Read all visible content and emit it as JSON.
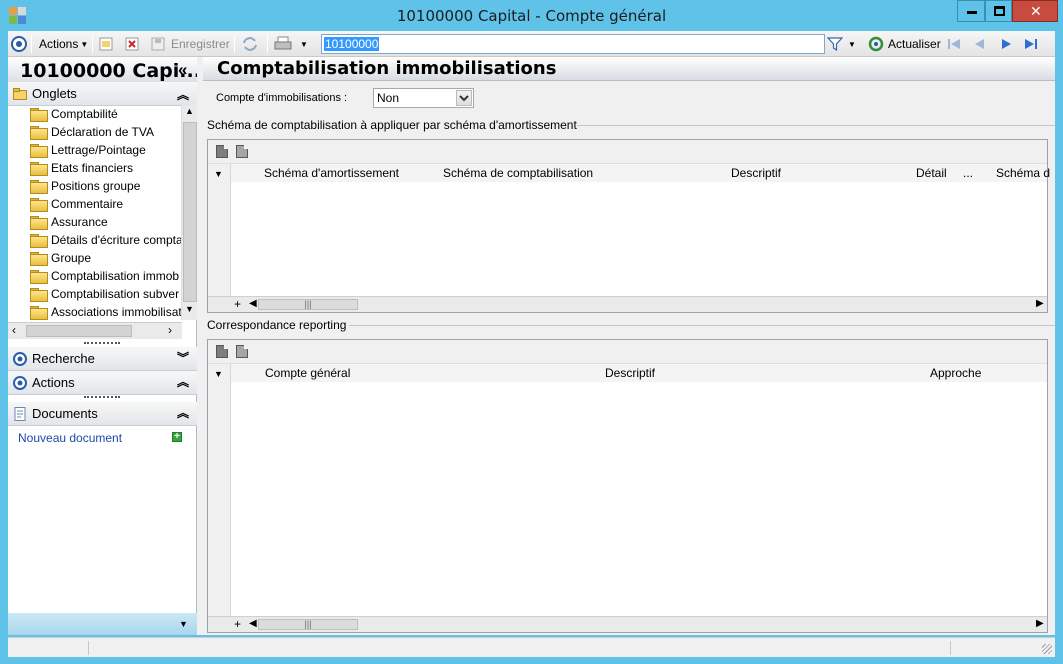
{
  "window": {
    "title": "10100000 Capital -  Compte général",
    "min_glyph": "▬",
    "max_glyph": "☐",
    "close_glyph": "✕"
  },
  "toolbar": {
    "actions_label": "Actions",
    "save_label": "Enregistrer",
    "search_value": "10100000",
    "refresh_label": "Actualiser"
  },
  "left_pane": {
    "title": "10100000 Capi...",
    "collapse_glyph": "«",
    "onglets_label": "Onglets",
    "tabs": [
      {
        "label": "Comptabilité"
      },
      {
        "label": "Déclaration de TVA"
      },
      {
        "label": "Lettrage/Pointage"
      },
      {
        "label": "Etats financiers"
      },
      {
        "label": "Positions groupe"
      },
      {
        "label": "Commentaire"
      },
      {
        "label": "Assurance"
      },
      {
        "label": "Détails d'écriture compta"
      },
      {
        "label": "Groupe"
      },
      {
        "label": "Comptabilisation immob"
      },
      {
        "label": "Comptabilisation subver"
      },
      {
        "label": "Associations immobilisat"
      }
    ],
    "recherche_label": "Recherche",
    "actions_label": "Actions",
    "documents_label": "Documents",
    "nouveau_document": "Nouveau document"
  },
  "main": {
    "title": "Comptabilisation immobilisations",
    "compte_label": "Compte d'immobilisations :",
    "compte_value": "Non",
    "group1_label": "Schéma de comptabilisation à appliquer par schéma d'amortissement",
    "grid1_columns": [
      {
        "label": "Schéma d'amortissement"
      },
      {
        "label": "Schéma de comptabilisation"
      },
      {
        "label": "Descriptif"
      },
      {
        "label": "Détail"
      },
      {
        "label": "..."
      },
      {
        "label": "Schéma d"
      }
    ],
    "group2_label": "Correspondance reporting",
    "grid2_columns": [
      {
        "label": "Compte général"
      },
      {
        "label": "Descriptif"
      },
      {
        "label": "Approche"
      }
    ]
  },
  "colors": {
    "window_frame": "#5fc3e9",
    "close_button": "#c74b3f",
    "selection": "#3399ff",
    "link": "#1d4aa8"
  }
}
